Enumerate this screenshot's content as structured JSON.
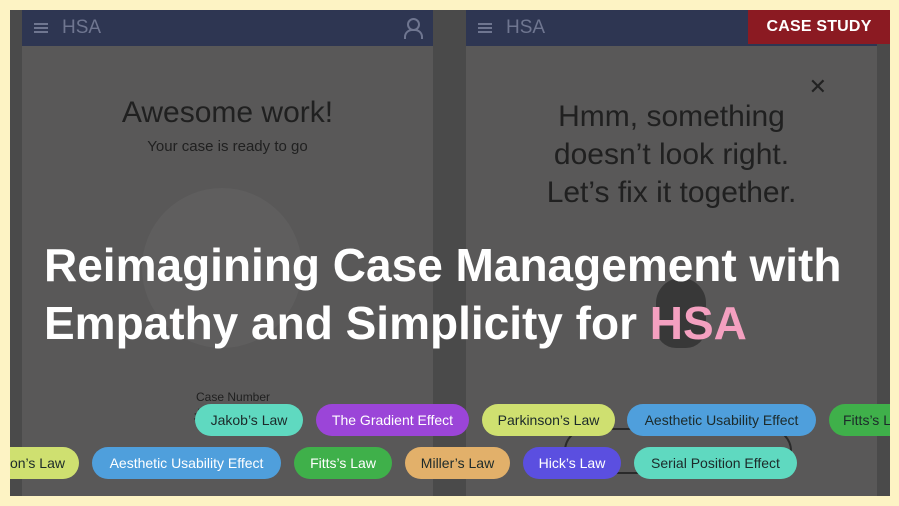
{
  "badge": "CASE STUDY",
  "title": {
    "line1": "Reimagining Case Management with",
    "line2_prefix": "Empathy and Simplicity for ",
    "line2_accent": "HSA"
  },
  "phone_left": {
    "app_title": "HSA",
    "heading": "Awesome work!",
    "subheading": "Your case is ready to go",
    "case_label": "Case Number",
    "case_value": "#"
  },
  "phone_right": {
    "app_title": "HSA",
    "heading_line1": "Hmm, something",
    "heading_line2": "doesn’t look right.",
    "heading_line3": "Let’s fix it together."
  },
  "tags_row1": [
    {
      "label": "Jakob’s Law",
      "color": "#5fd9c0"
    },
    {
      "label": "The Gradient Effect",
      "color": "#9b45d8"
    },
    {
      "label": "Parkinson’s Law",
      "color": "#cfe070"
    },
    {
      "label": "Aesthetic Usability Effect",
      "color": "#4f9fdc"
    },
    {
      "label": "Fitts’s Law",
      "color": "#3fb04a"
    }
  ],
  "tags_row2": [
    {
      "label": "on’s Law",
      "color": "#cfe070"
    },
    {
      "label": "Aesthetic Usability Effect",
      "color": "#4f9fdc"
    },
    {
      "label": "Fitts’s Law",
      "color": "#3fb04a"
    },
    {
      "label": "Miller’s Law",
      "color": "#e2b06a"
    },
    {
      "label": "Hick’s Law",
      "color": "#5b4fe0"
    },
    {
      "label": "Serial Position Effect",
      "color": "#5fd9c0"
    }
  ],
  "colors": {
    "background": "#fdf3c4",
    "badge": "#8b1a22",
    "accent": "#f4a0c0",
    "appbar": "#2e3652"
  }
}
